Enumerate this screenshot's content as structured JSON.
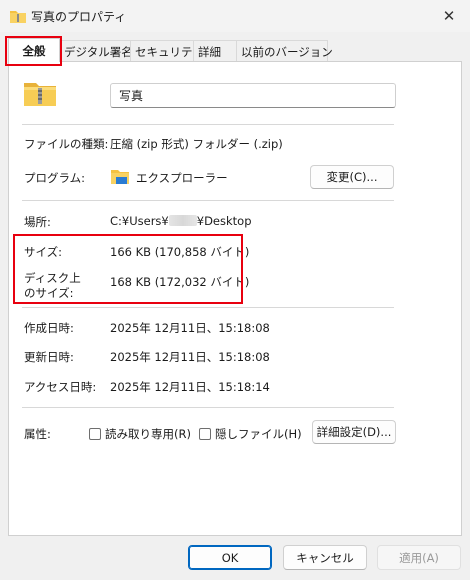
{
  "window": {
    "title": "写真のプロパティ",
    "close_glyph": "✕"
  },
  "tabs": [
    {
      "label": "全般"
    },
    {
      "label": "デジタル署名"
    },
    {
      "label": "セキュリティ"
    },
    {
      "label": "詳細"
    },
    {
      "label": "以前のバージョン"
    }
  ],
  "general": {
    "name": "写真",
    "filetype_label": "ファイルの種類:",
    "filetype_value": "圧縮 (zip 形式) フォルダー (.zip)",
    "program_label": "プログラム:",
    "program_value": "エクスプローラー",
    "change_button": "変更(C)...",
    "location_label": "場所:",
    "location_prefix": "C:¥Users¥",
    "location_suffix": "¥Desktop",
    "size_label": "サイズ:",
    "size_value": "166 KB (170,858 バイト)",
    "disk_size_label_1": "ディスク上",
    "disk_size_label_2": "のサイズ:",
    "disk_size_value": "168 KB (172,032 バイト)",
    "created_label": "作成日時:",
    "created_value": "2025年 12月11日、15:18:08",
    "modified_label": "更新日時:",
    "modified_value": "2025年 12月11日、15:18:08",
    "accessed_label": "アクセス日時:",
    "accessed_value": "2025年 12月11日、15:18:14",
    "attributes_label": "属性:",
    "readonly_label": "読み取り専用(R)",
    "readonly_checked": false,
    "hidden_label": "隠しファイル(H)",
    "hidden_checked": false,
    "advanced_button": "詳細設定(D)..."
  },
  "footer": {
    "ok": "OK",
    "cancel": "キャンセル",
    "apply": "適用(A)"
  },
  "colors": {
    "highlight": "#e8000f",
    "accent": "#0067c0",
    "folder": "#f5c242"
  }
}
